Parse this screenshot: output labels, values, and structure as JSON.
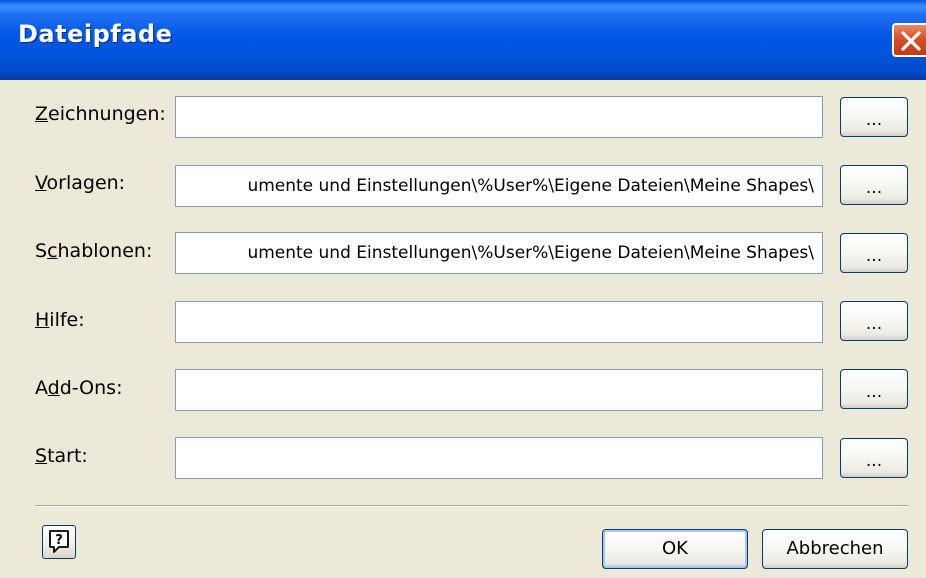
{
  "window": {
    "title": "Dateipfade"
  },
  "rows": [
    {
      "mnemonic": "Z",
      "rest": "eichnungen:",
      "value": "",
      "browse": "..."
    },
    {
      "mnemonic": "V",
      "rest": "orlagen:",
      "value": "umente und Einstellungen\\%User%\\Eigene Dateien\\Meine Shapes\\",
      "browse": "..."
    },
    {
      "pre": "S",
      "mnemonic": "c",
      "rest": "hablonen:",
      "value": "umente und Einstellungen\\%User%\\Eigene Dateien\\Meine Shapes\\",
      "browse": "..."
    },
    {
      "mnemonic": "H",
      "rest": "ilfe:",
      "value": "",
      "browse": "..."
    },
    {
      "pre": "A",
      "mnemonic": "d",
      "rest": "d-Ons:",
      "value": "",
      "browse": "..."
    },
    {
      "mnemonic": "S",
      "rest": "tart:",
      "value": "",
      "browse": "..."
    }
  ],
  "footer": {
    "ok_label": "OK",
    "cancel_label": "Abbrechen"
  },
  "icons": {
    "close": "close-icon",
    "help": "help-icon"
  }
}
